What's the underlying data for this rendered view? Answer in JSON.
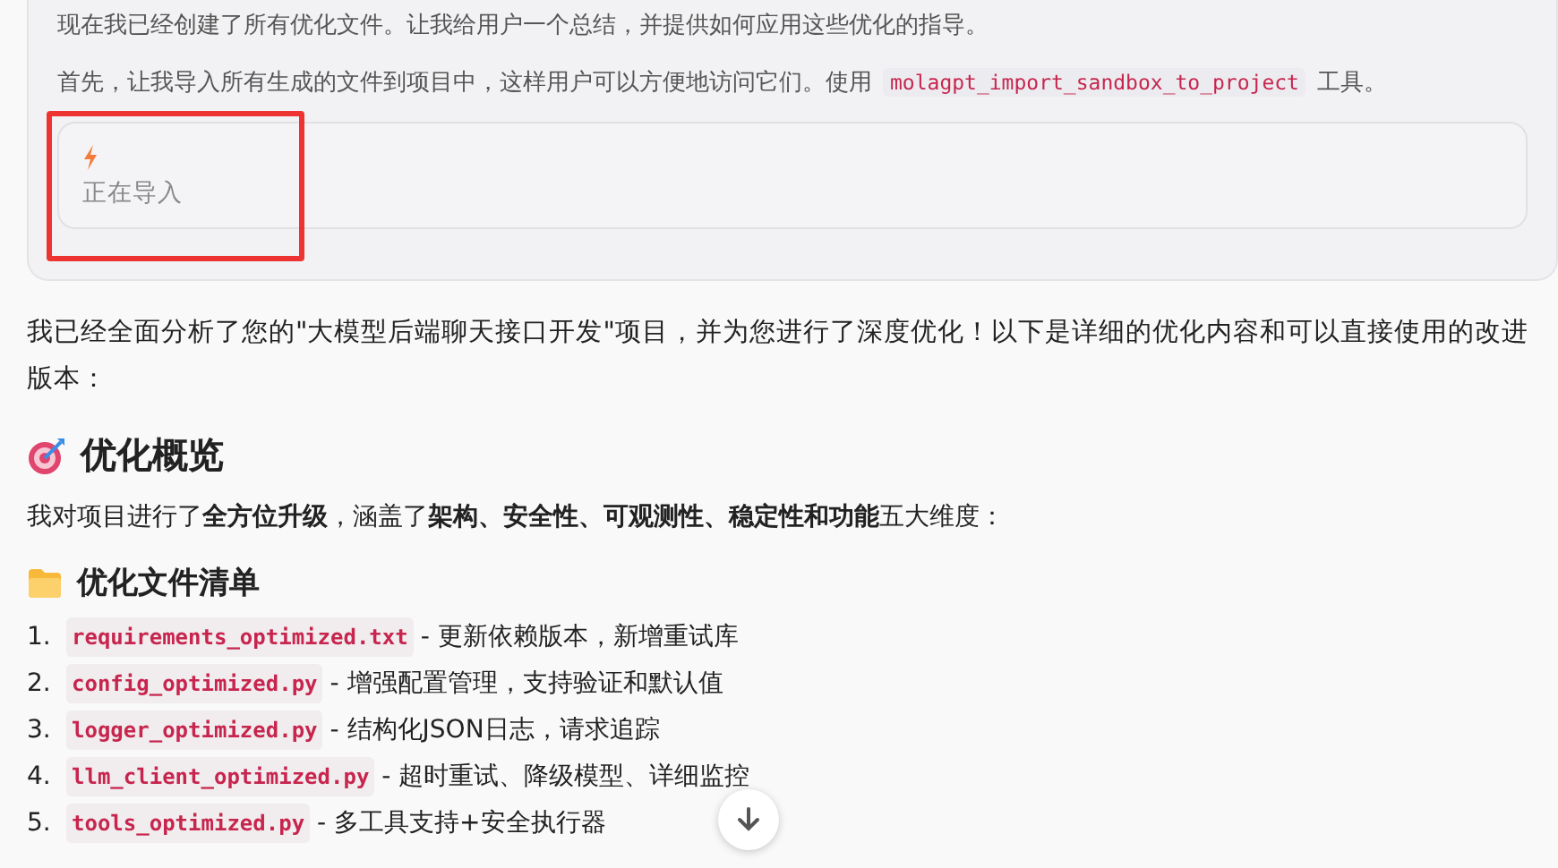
{
  "thinking_card": {
    "paragraphs": [
      {
        "text": "现在我已经创建了所有优化文件。让我给用户一个总结，并提供如何应用这些优化的指导。"
      },
      {
        "text": "首先，让我导入所有生成的文件到项目中，这样用户可以方便地访问它们。使用",
        "code": "molagpt_import_sandbox_to_project",
        "after": "工具。"
      }
    ],
    "tool_call": {
      "status": "正在导入",
      "highlighted": true
    }
  },
  "intro": "我已经全面分析了您的\"大模型后端聊天接口开发\"项目，并为您进行了深度优化！以下是详细的优化内容和可以直接使用的改进版本：",
  "sections": [
    {
      "kind": "target",
      "title": "优化概览",
      "body": "我对项目进行了**全方位升级**，涵盖了**架构、安全性、可观测性、稳定性和功能**五大维度："
    },
    {
      "kind": "folder",
      "title": "优化文件清单",
      "items": [
        {
          "number": "1.",
          "file": "requirements_optimized.txt",
          "desc": "- 更新依赖版本，新增重试库"
        },
        {
          "number": "2.",
          "file": "config_optimized.py",
          "desc": "- 增强配置管理，支持验证和默认值"
        },
        {
          "number": "3.",
          "file": "logger_optimized.py",
          "desc": "- 结构化JSON日志，请求追踪"
        },
        {
          "number": "4.",
          "file": "llm_client_optimized.py",
          "desc": "- 超时重试、降级模型、详细监控"
        },
        {
          "number": "5.",
          "file": "tools_optimized.py",
          "desc": "- 多工具支持+安全执行器"
        }
      ]
    }
  ],
  "scroll_button": {
    "visible": true
  }
}
